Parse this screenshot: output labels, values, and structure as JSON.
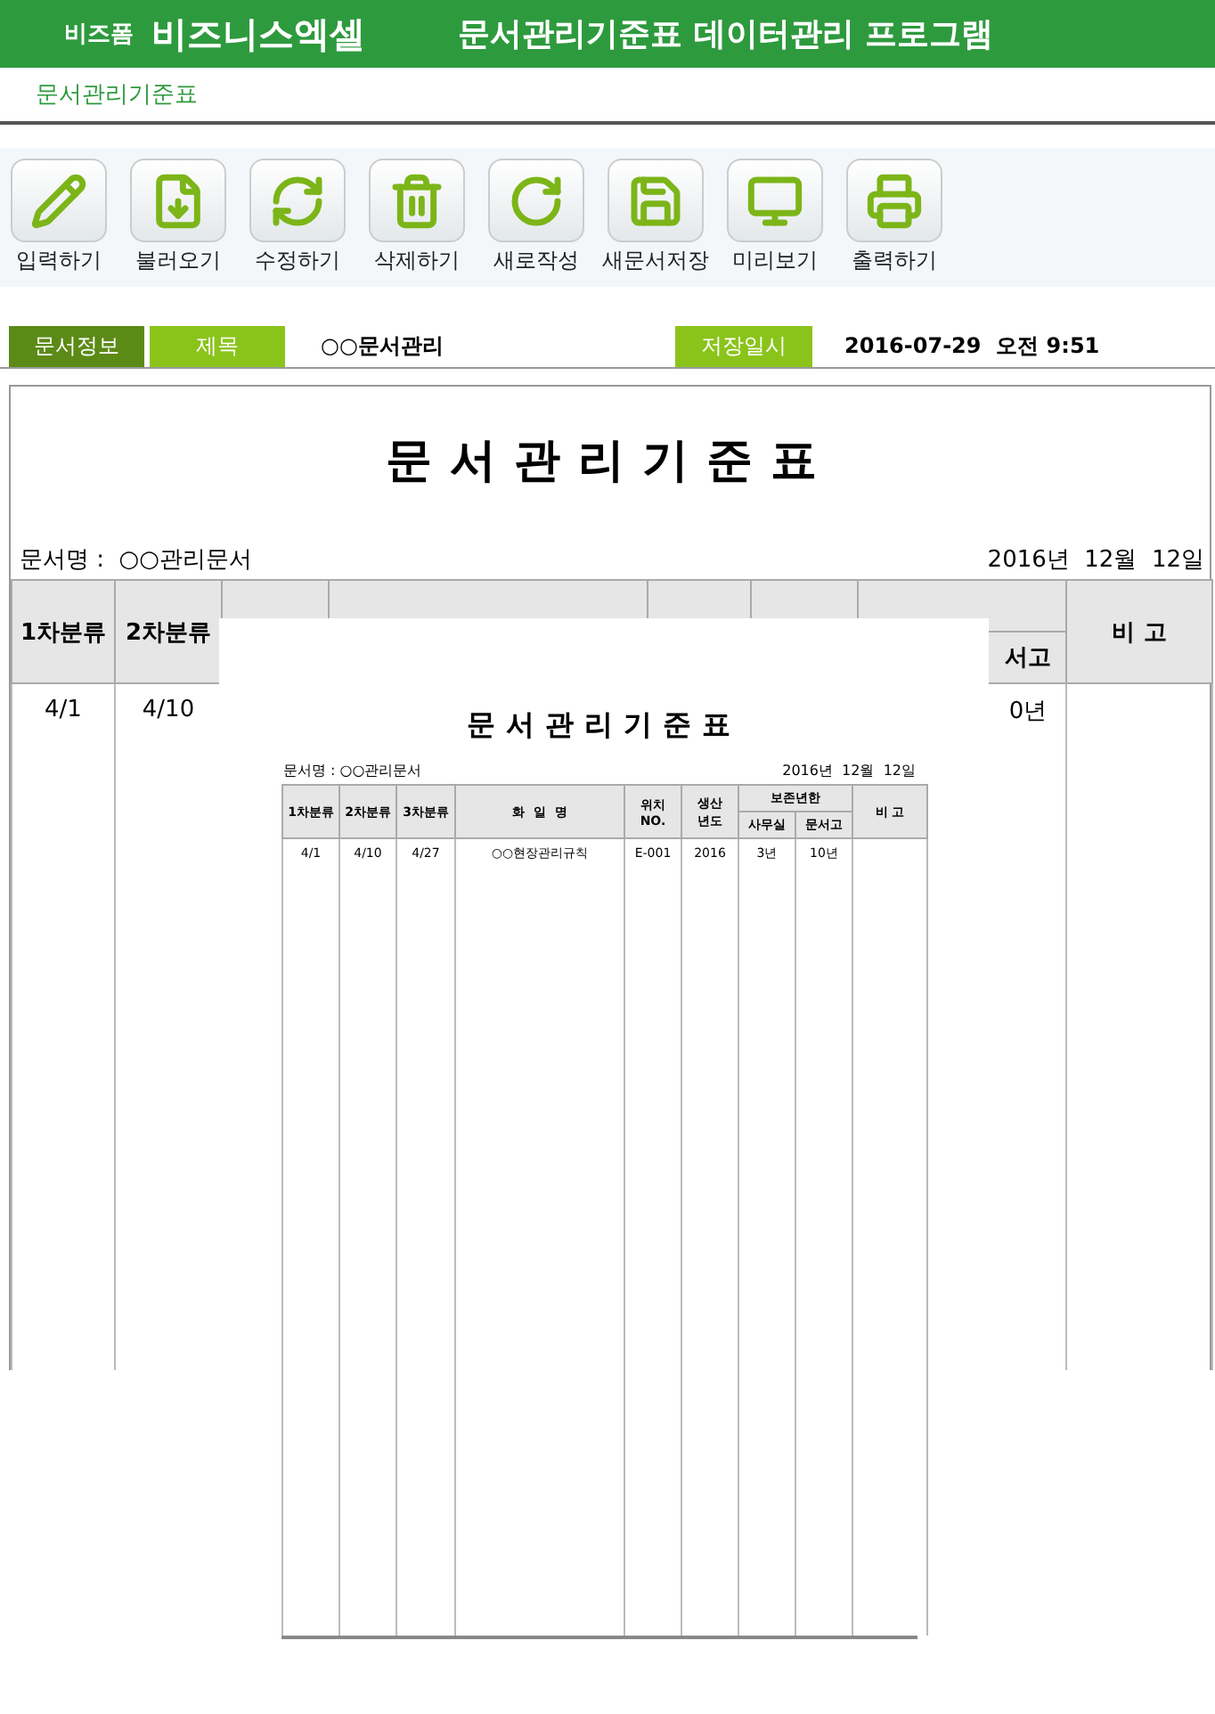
{
  "header": {
    "brand_small": "비즈폼",
    "brand": "비즈니스엑셀",
    "title": "문서관리기준표 데이터관리 프로그램"
  },
  "subtitle": "문서관리기준표",
  "toolbar": [
    {
      "label": "입력하기"
    },
    {
      "label": "불러오기"
    },
    {
      "label": "수정하기"
    },
    {
      "label": "삭제하기"
    },
    {
      "label": "새로작성"
    },
    {
      "label": "새문서저장"
    },
    {
      "label": "미리보기"
    },
    {
      "label": "출력하기"
    }
  ],
  "info_bar": {
    "section": "문서정보",
    "title_label": "제목",
    "title_value": "○○문서관리",
    "saved_label": "저장일시",
    "saved_value": "2016-07-29  오전 9:51"
  },
  "sheet": {
    "title": "문서관리기준표",
    "doc_name": "문서명 :  ○○관리문서",
    "date": "2016년  12월  12일",
    "headers": {
      "column_1": "1차분류",
      "column_2": "2차분류",
      "column_8": "서고",
      "column_9": "비 고"
    },
    "row": {
      "column_1": "4/1",
      "column_2": "4/10",
      "column_8": "0년"
    }
  },
  "preview": {
    "title": "문서관리기준표",
    "doc_name": "문서명 : ○○관리문서",
    "date": "2016년  12월  12일",
    "columns": [
      {
        "label": "1차분류"
      },
      {
        "label": "2차분류"
      },
      {
        "label": "3차분류"
      },
      {
        "label": "화  일  명"
      },
      {
        "label": "위치\nNO."
      },
      {
        "label": "생산\n년도"
      },
      {
        "label": "보존년한",
        "children": [
          {
            "label": "사무실"
          },
          {
            "label": "문서고"
          }
        ]
      },
      {
        "label": "비 고"
      }
    ],
    "row": [
      {
        "text": "4/1"
      },
      {
        "text": "4/10"
      },
      {
        "text": "4/27"
      },
      {
        "text": "○○현장관리규칙"
      },
      {
        "text": "E-001"
      },
      {
        "text": "2016"
      },
      {
        "text": "3년"
      },
      {
        "text": "10년"
      }
    ]
  }
}
